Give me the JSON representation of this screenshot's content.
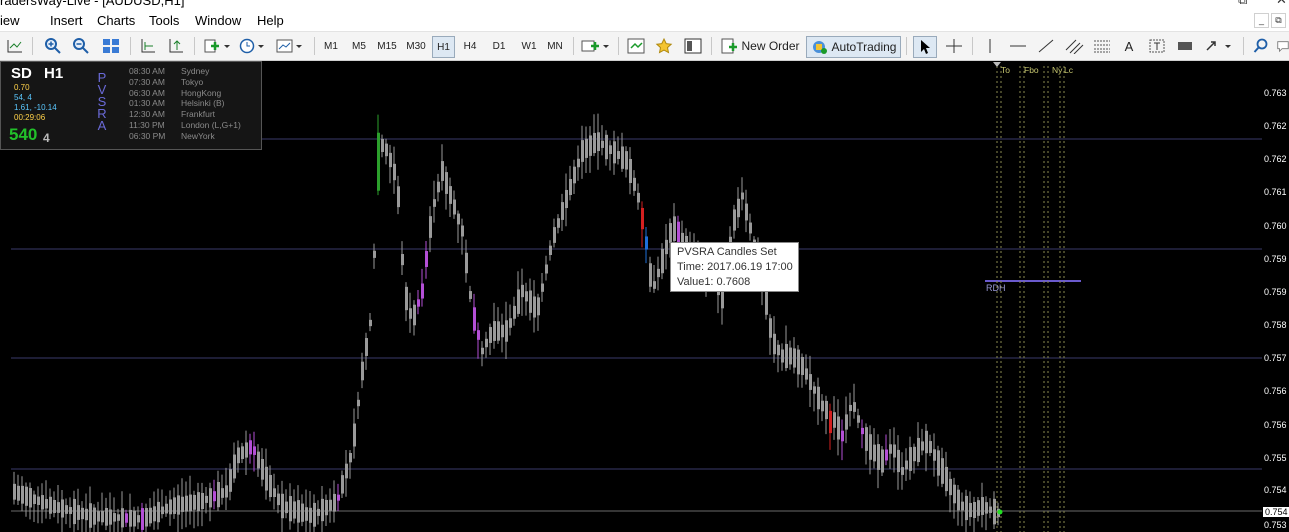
{
  "window": {
    "title": "radersWay-Live - [AUDUSD,H1]"
  },
  "menu": [
    "iew",
    "Insert",
    "Charts",
    "Tools",
    "Window",
    "Help"
  ],
  "toolbar": {
    "timeframes": [
      "M1",
      "M5",
      "M15",
      "M30",
      "H1",
      "H4",
      "D1",
      "W1",
      "MN"
    ],
    "active_timeframe": "H1",
    "new_order": "New Order",
    "autotrading": "AutoTrading",
    "text_tool": "A"
  },
  "info_panel": {
    "symbol": "SD",
    "timeframe": "H1",
    "stat1": "0.70",
    "stat2": "54, 4",
    "stat3": "1.61, -10.14",
    "timer": "00:29:06",
    "big_value": "540",
    "big_suffix": "4",
    "vertical_label": [
      "P",
      "V",
      "S",
      "R",
      "A"
    ],
    "sessions": [
      {
        "time": "08:30 AM",
        "city": "Sydney"
      },
      {
        "time": "07:30 AM",
        "city": "Tokyo"
      },
      {
        "time": "06:30 AM",
        "city": "HongKong"
      },
      {
        "time": "01:30 AM",
        "city": "Helsinki  (B)"
      },
      {
        "time": "12:30 AM",
        "city": "Frankfurt"
      },
      {
        "time": "11:30 PM",
        "city": "London  (L,G+1)"
      },
      {
        "time": "06:30 PM",
        "city": "NewYork"
      }
    ]
  },
  "session_markers": [
    "To",
    "Fbo",
    "Ny",
    "Lc"
  ],
  "rdh_label": "RDH",
  "tooltip": {
    "line1": "PVSRA Candles Set",
    "line2": "Time: 2017.06.19 17:00",
    "line3": "Value1: 0.7608"
  },
  "price_scale": {
    "labels": [
      "0.763",
      "0.762",
      "0.762",
      "0.761",
      "0.760",
      "0.759",
      "0.759",
      "0.758",
      "0.757",
      "0.756",
      "0.756",
      "0.755",
      "0.754",
      "0.754",
      "0.753"
    ],
    "current_price": "0.754"
  },
  "colors": {
    "chart_background": "#000000",
    "candle_neutral": "#9a9a9a",
    "candle_bull_climax": "#2ca02c",
    "candle_bear_climax": "#d42020",
    "candle_bull_rising": "#1e6fd9",
    "candle_bear_rising": "#b44fd6",
    "horizontal_lines": "#3a3a6a",
    "rdh_line": "#6a5acd",
    "vertical_session_lines": "#8a8a50"
  }
}
